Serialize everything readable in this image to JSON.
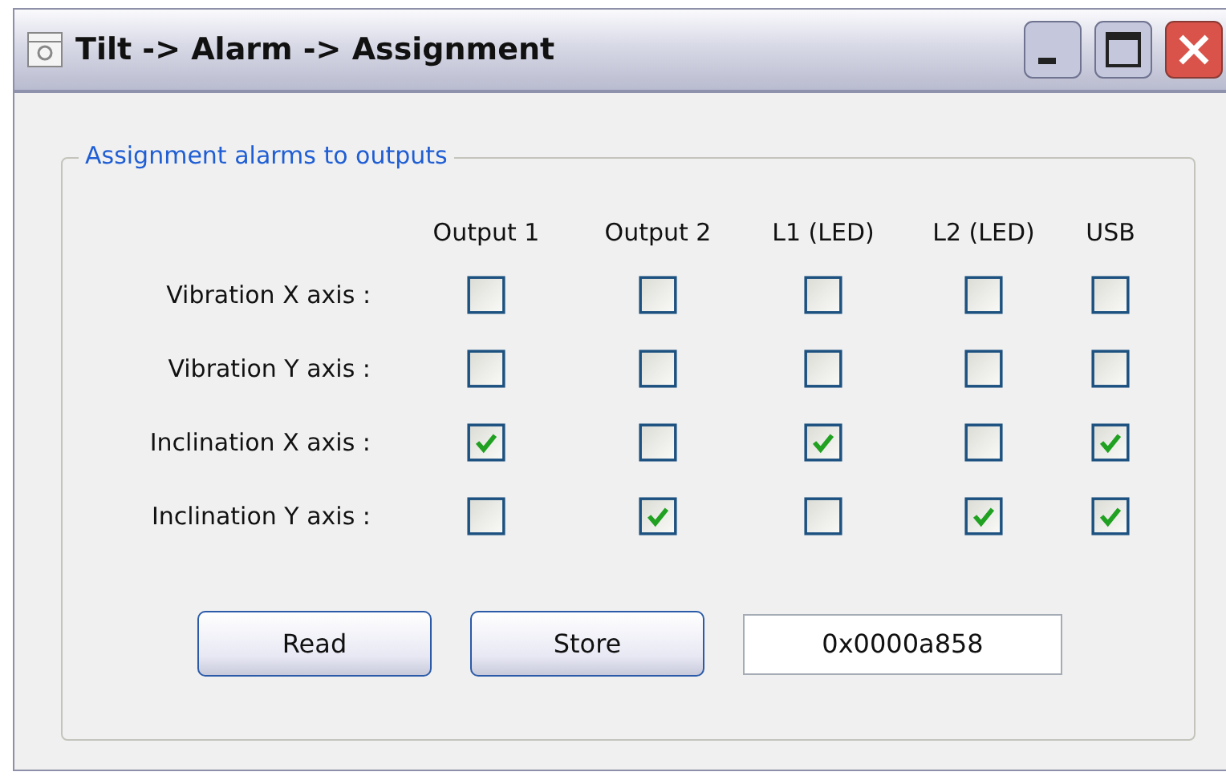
{
  "window": {
    "title": "Tilt -> Alarm -> Assignment"
  },
  "group": {
    "title": "Assignment alarms to outputs",
    "columns": [
      "Output 1",
      "Output 2",
      "L1 (LED)",
      "L2 (LED)",
      "USB"
    ],
    "rows": [
      {
        "label": "Vibration X axis :",
        "checks": [
          {
            "checked": false
          },
          {
            "checked": false
          },
          {
            "checked": false
          },
          {
            "checked": false
          },
          {
            "checked": false
          }
        ]
      },
      {
        "label": "Vibration Y axis :",
        "checks": [
          {
            "checked": false
          },
          {
            "checked": false
          },
          {
            "checked": false
          },
          {
            "checked": false
          },
          {
            "checked": false
          }
        ]
      },
      {
        "label": "Inclination X axis :",
        "checks": [
          {
            "checked": true
          },
          {
            "checked": false
          },
          {
            "checked": true
          },
          {
            "checked": false
          },
          {
            "checked": true
          }
        ]
      },
      {
        "label": "Inclination Y axis :",
        "checks": [
          {
            "checked": false
          },
          {
            "checked": true
          },
          {
            "checked": false
          },
          {
            "checked": true
          },
          {
            "checked": true
          }
        ]
      }
    ]
  },
  "buttons": [
    "Read",
    "Store"
  ],
  "value_field": {
    "value": "0x0000a858"
  }
}
